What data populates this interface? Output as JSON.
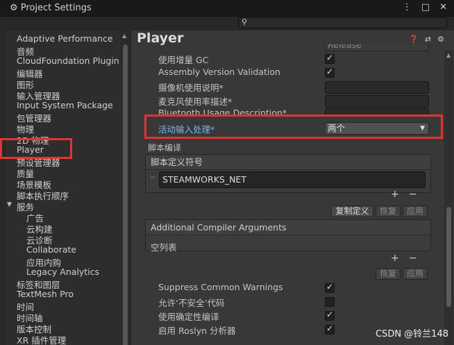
{
  "window": {
    "title": "Project Settings",
    "icons": [
      "menu-icon",
      "maximize-icon",
      "close-icon"
    ]
  },
  "search": {
    "placeholder": ""
  },
  "sidebar": {
    "items": [
      "Adaptive Performance",
      "音频",
      "CloudFoundation Plugin",
      "编辑器",
      "图形",
      "输入管理器",
      "Input System Package",
      "包管理器",
      "物理",
      "2D 物理",
      "Player",
      "预设管理器",
      "质量",
      "场景模板",
      "脚本执行顺序",
      "服务",
      "广告",
      "云构建",
      "云诊断",
      "Collaborate",
      "应用内购",
      "Legacy Analytics",
      "标签和图层",
      "TextMesh Pro",
      "时间",
      "时间轴",
      "版本控制",
      "XR 插件管理"
    ]
  },
  "main": {
    "title": "Player",
    "header_icons": [
      "help-icon",
      "preset-icon",
      "gear-icon"
    ],
    "rows": [
      {
        "label": "使用增量 GC",
        "type": "checkbox",
        "checked": true
      },
      {
        "label": "Assembly Version Validation",
        "type": "checkbox",
        "checked": true
      },
      {
        "label": "摄像机使用说明*",
        "type": "text",
        "value": ""
      },
      {
        "label": "麦克风使用率描述*",
        "type": "text",
        "value": ""
      },
      {
        "label": "Bluetooth Usage Description*",
        "type": "text",
        "value": ""
      },
      {
        "label": "活动输入处理*",
        "type": "dropdown",
        "value": "两个"
      }
    ],
    "partial_top_value": "Release",
    "script_compile": {
      "section": "脚本编译",
      "define_symbols_header": "脚本定义符号",
      "define_symbol_value": "STEAMWORKS_NET",
      "buttons": {
        "copy": "复制定义",
        "revert": "恢复",
        "apply": "应用"
      },
      "additional_args_header": "Additional Compiler Arguments",
      "empty_list": "空列表",
      "buttons2": {
        "revert": "恢复",
        "apply": "应用"
      }
    },
    "bottom_rows": [
      {
        "label": "Suppress Common Warnings",
        "checked": true
      },
      {
        "label": "允许‘不安全’代码",
        "checked": false
      },
      {
        "label": "使用确定性编译",
        "checked": true
      },
      {
        "label": "启用 Roslyn 分析器",
        "checked": true
      }
    ]
  },
  "watermark": "CSDN @铃兰148",
  "colors": {
    "highlight": "#e53333",
    "accent_blue": "#7fb2f0"
  }
}
